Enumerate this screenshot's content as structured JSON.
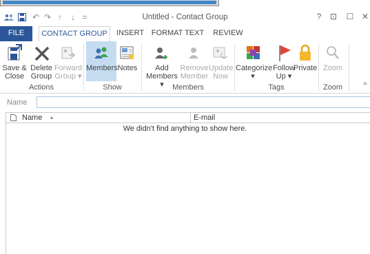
{
  "window": {
    "title": "Untitled - Contact Group",
    "help_label": "?",
    "ribbon_display_label": "⊡",
    "maximize_label": "☐",
    "close_label": "✕"
  },
  "qat": {
    "undo_label": "↶",
    "redo_label": "↷",
    "up_label": "↑",
    "down_label": "↓",
    "customize_label": "="
  },
  "tabs": [
    "FILE",
    "CONTACT GROUP",
    "INSERT",
    "FORMAT TEXT",
    "REVIEW"
  ],
  "ribbon": {
    "buttons": {
      "save_close": [
        "Save &",
        "Close"
      ],
      "delete_group": [
        "Delete",
        "Group"
      ],
      "forward_group": [
        "Forward",
        "Group ▾"
      ],
      "members": "Members",
      "notes": "Notes",
      "add_members": [
        "Add",
        "Members ▾"
      ],
      "remove_member": [
        "Remove",
        "Member"
      ],
      "update_now": [
        "Update",
        "Now"
      ],
      "categorize": [
        "Categorize",
        "▾"
      ],
      "follow_up": [
        "Follow",
        "Up ▾"
      ],
      "private": "Private",
      "zoom": "Zoom"
    },
    "groups": [
      "Actions",
      "Show",
      "Members",
      "Tags",
      "Zoom"
    ],
    "collapse_label": "^"
  },
  "name_field": {
    "label": "Name",
    "value": ""
  },
  "list": {
    "columns": [
      "Name",
      "E-mail"
    ],
    "sort_indicator": "▲",
    "empty_message": "We didn't find anything to show here."
  },
  "colors": {
    "file_tab": "#2b579a",
    "accent": "#2b579a",
    "selected_button": "#c5dcf0"
  }
}
